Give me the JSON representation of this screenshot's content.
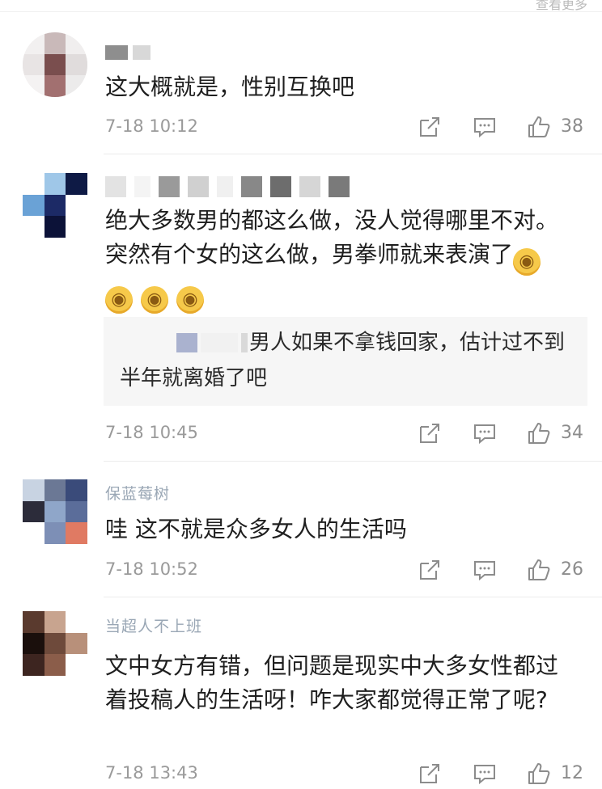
{
  "top_status": "查看更多",
  "comments": [
    {
      "text": "这大概就是，性别互换吧",
      "time": "7-18 10:12",
      "likes": "38"
    },
    {
      "text": "绝大多数男的都这么做，没人觉得哪里不对。突然有个女的这么做，男拳师就来表演了",
      "emojis": [
        "doge-emoji",
        "doge-emoji",
        "doge-emoji",
        "doge-emoji"
      ],
      "reply_text": "男人如果不拿钱回家，估计过不到半年就离婚了吧",
      "time": "7-18 10:45",
      "likes": "34"
    },
    {
      "username": "保蓝莓树",
      "text": "哇 这不就是众多女人的生活吗",
      "time": "7-18 10:52",
      "likes": "26"
    },
    {
      "username": "当超人不上班",
      "text": "文中女方有错，但问题是现实中大多女性都过着投稿人的生活呀！咋大家都觉得正常了呢?",
      "time": "7-18 13:43",
      "likes": "12"
    }
  ],
  "icons": [
    "share-icon",
    "comment-icon",
    "like-icon"
  ],
  "colors": {
    "meta": "#9a9a9a",
    "quote_bg": "#f6f6f6",
    "emoji": "#f6c94a"
  }
}
